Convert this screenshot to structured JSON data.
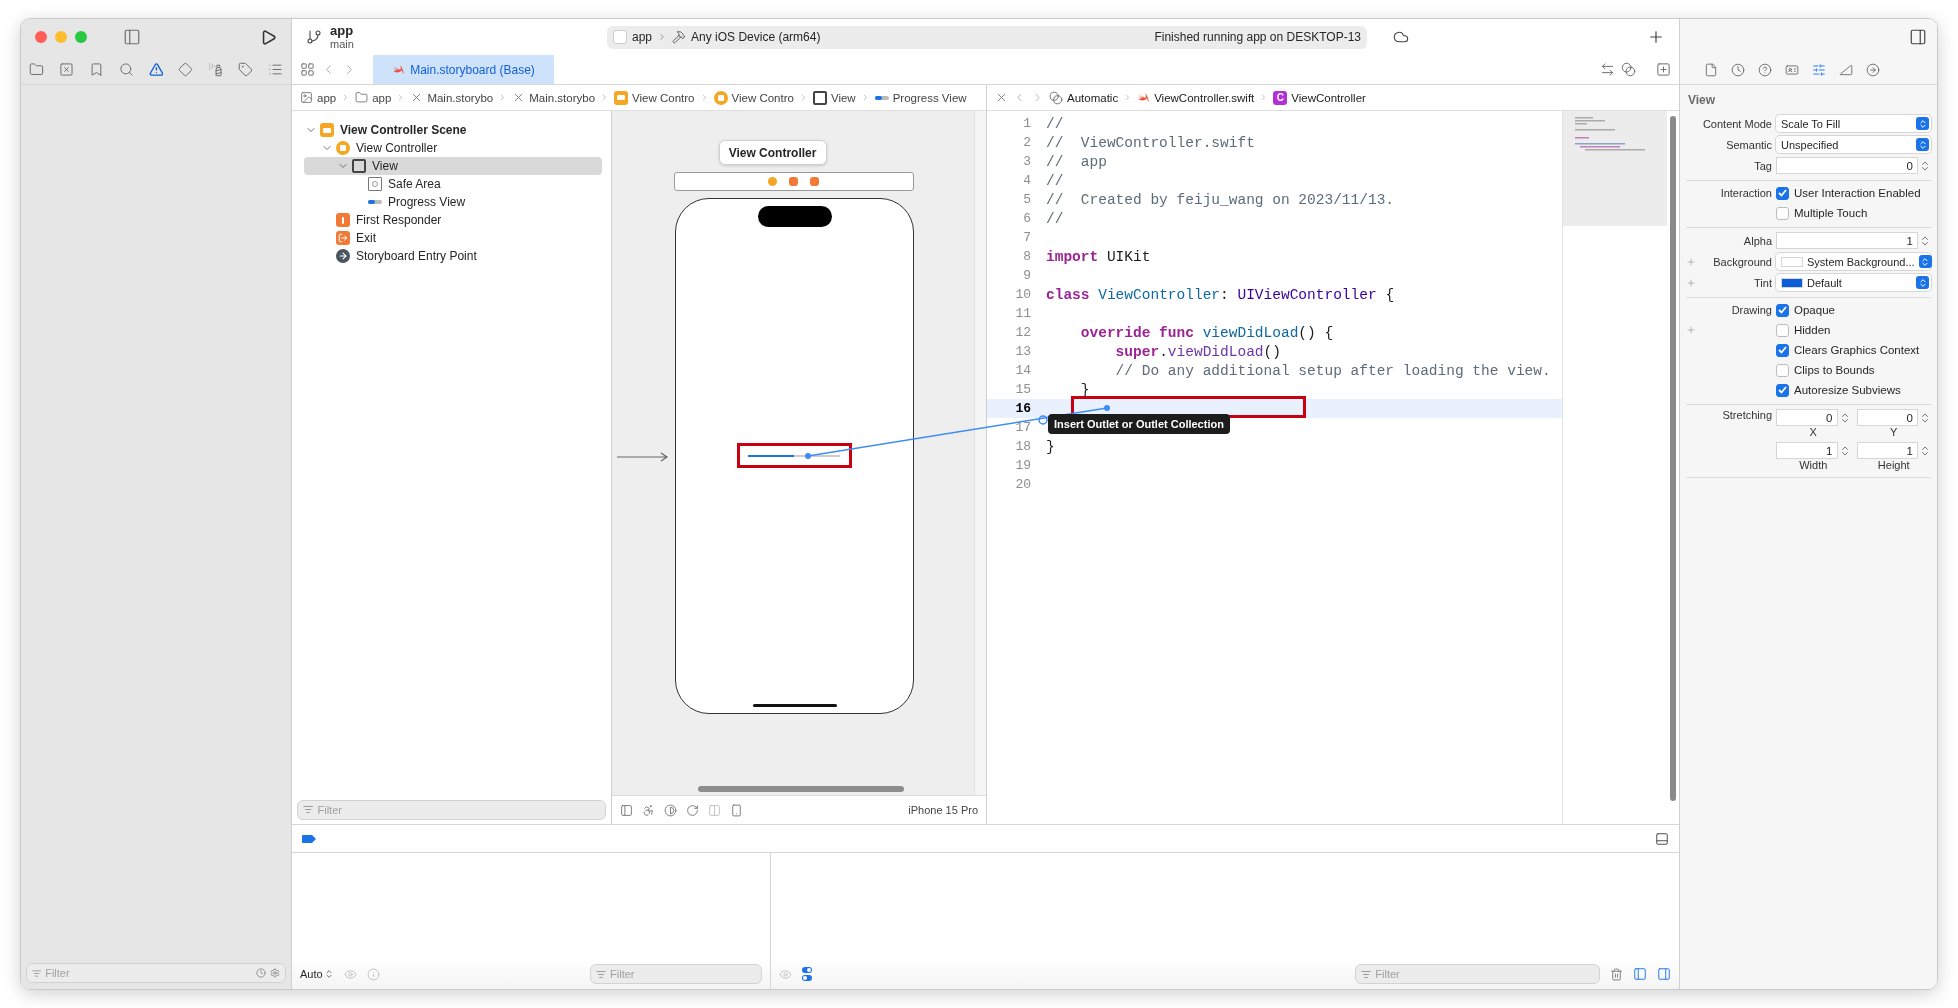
{
  "toolbar": {
    "project": "app",
    "branch": "main",
    "scheme": "app",
    "destination": "Any iOS Device (arm64)",
    "status": "Finished running app on DESKTOP-13"
  },
  "navigator": {
    "filter": {
      "placeholder": "Filter"
    }
  },
  "editor_tabs": [
    {
      "label": "Main.storyboard (Base)",
      "selected": true
    }
  ],
  "storyboard": {
    "breadcrumbs": [
      {
        "kind": "project",
        "label": "app"
      },
      {
        "kind": "folder",
        "label": "app"
      },
      {
        "kind": "storyboard",
        "label": "Main.storybo"
      },
      {
        "kind": "storyboard",
        "label": "Main.storybo"
      },
      {
        "kind": "scene",
        "label": "View Contro"
      },
      {
        "kind": "controller",
        "label": "View Contro"
      },
      {
        "kind": "view",
        "label": "View"
      },
      {
        "kind": "progress",
        "label": "Progress View"
      }
    ],
    "outline": [
      {
        "kind": "scene",
        "label": "View Controller Scene",
        "expanded": true,
        "selected": false,
        "children": [
          {
            "kind": "controller",
            "label": "View Controller",
            "expanded": true,
            "selected": false,
            "children": [
              {
                "kind": "view",
                "label": "View",
                "expanded": true,
                "selected": true,
                "children": [
                  {
                    "kind": "safe-area",
                    "label": "Safe Area",
                    "selected": false
                  },
                  {
                    "kind": "progress",
                    "label": "Progress View",
                    "selected": false
                  }
                ]
              }
            ]
          },
          {
            "kind": "responder",
            "label": "First Responder",
            "selected": false
          },
          {
            "kind": "exit",
            "label": "Exit",
            "selected": false
          },
          {
            "kind": "entry",
            "label": "Storyboard Entry Point",
            "selected": false
          }
        ]
      }
    ],
    "outline_filter": {
      "placeholder": "Filter"
    },
    "scene_title": "View Controller",
    "device": "iPhone 15 Pro"
  },
  "assistant": {
    "breadcrumbs": [
      {
        "kind": "mode",
        "label": "Automatic"
      },
      {
        "kind": "file",
        "label": "ViewController.swift"
      },
      {
        "kind": "class",
        "badge": "C",
        "label": "ViewController"
      }
    ],
    "lines": [
      {
        "number": "1",
        "highlighted": false,
        "tokens": [
          {
            "kind": "comment",
            "text": "//"
          }
        ]
      },
      {
        "number": "2",
        "highlighted": false,
        "tokens": [
          {
            "kind": "comment",
            "text": "//  ViewController.swift"
          }
        ]
      },
      {
        "number": "3",
        "highlighted": false,
        "tokens": [
          {
            "kind": "comment",
            "text": "//  app"
          }
        ]
      },
      {
        "number": "4",
        "highlighted": false,
        "tokens": [
          {
            "kind": "comment",
            "text": "//"
          }
        ]
      },
      {
        "number": "5",
        "highlighted": false,
        "tokens": [
          {
            "kind": "comment",
            "text": "//  Created by feiju_wang on 2023/11/13."
          }
        ]
      },
      {
        "number": "6",
        "highlighted": false,
        "tokens": [
          {
            "kind": "comment",
            "text": "//"
          }
        ]
      },
      {
        "number": "7",
        "highlighted": false
      },
      {
        "number": "8",
        "highlighted": false,
        "tokens": [
          {
            "kind": "keyword",
            "text": "import"
          },
          {
            "kind": "plain",
            "text": " UIKit"
          }
        ]
      },
      {
        "number": "9",
        "highlighted": false
      },
      {
        "number": "10",
        "highlighted": false,
        "tokens": [
          {
            "kind": "keyword",
            "text": "class"
          },
          {
            "kind": "decl",
            "text": " ViewController"
          },
          {
            "kind": "plain",
            "text": ": "
          },
          {
            "kind": "type",
            "text": "UIViewController"
          },
          {
            "kind": "plain",
            "text": " {"
          }
        ]
      },
      {
        "number": "11",
        "highlighted": false
      },
      {
        "number": "12",
        "highlighted": false,
        "tokens": [
          {
            "kind": "keyword",
            "text": "    override func"
          },
          {
            "kind": "decl",
            "text": " viewDidLoad"
          },
          {
            "kind": "plain",
            "text": "() {"
          }
        ]
      },
      {
        "number": "13",
        "highlighted": false,
        "tokens": [
          {
            "kind": "keyword",
            "text": "        super"
          },
          {
            "kind": "plain",
            "text": "."
          },
          {
            "kind": "call",
            "text": "viewDidLoad"
          },
          {
            "kind": "plain",
            "text": "()"
          }
        ]
      },
      {
        "number": "14",
        "highlighted": false,
        "tokens": [
          {
            "kind": "comment",
            "text": "        // Do any additional setup after loading the view."
          }
        ]
      },
      {
        "number": "15",
        "highlighted": false,
        "tokens": [
          {
            "kind": "plain",
            "text": "    }"
          }
        ]
      },
      {
        "number": "16",
        "highlighted": true
      },
      {
        "number": "17",
        "highlighted": false
      },
      {
        "number": "18",
        "highlighted": false,
        "tokens": [
          {
            "kind": "plain",
            "text": "}"
          }
        ]
      },
      {
        "number": "19",
        "highlighted": false
      },
      {
        "number": "20",
        "highlighted": false
      }
    ],
    "tooltip": "Insert Outlet or Outlet Collection"
  },
  "inspector": {
    "title": "View",
    "sections": [
      [
        {
          "kind": "popup",
          "label": "Content Mode",
          "value": "Scale To Fill",
          "plus": false
        },
        {
          "kind": "popup",
          "label": "Semantic",
          "value": "Unspecified",
          "plus": false
        },
        {
          "kind": "stepper",
          "label": "Tag",
          "value": "0",
          "plus": false
        }
      ],
      [
        {
          "kind": "checkbox",
          "label": "Interaction",
          "text": "User Interaction Enabled",
          "checked": true,
          "plus": false
        },
        {
          "kind": "checkbox",
          "text": "Multiple Touch",
          "checked": false,
          "plus": false
        }
      ],
      [
        {
          "kind": "stepper",
          "label": "Alpha",
          "value": "1",
          "plus": false
        },
        {
          "kind": "color",
          "label": "Background",
          "value": "System Background...",
          "color": "#ffffff",
          "plus": true
        },
        {
          "kind": "color",
          "label": "Tint",
          "value": "Default",
          "color": "#0b5ed7",
          "plus": true
        }
      ],
      [
        {
          "kind": "checkbox",
          "label": "Drawing",
          "text": "Opaque",
          "checked": true,
          "plus": false
        },
        {
          "kind": "checkbox",
          "text": "Hidden",
          "checked": false,
          "plus": true
        },
        {
          "kind": "checkbox",
          "text": "Clears Graphics Context",
          "checked": true,
          "plus": false
        },
        {
          "kind": "checkbox",
          "text": "Clips to Bounds",
          "checked": false,
          "plus": false
        },
        {
          "kind": "checkbox",
          "text": "Autoresize Subviews",
          "checked": true,
          "plus": false
        }
      ],
      [
        {
          "kind": "pair",
          "label": "Stretching",
          "plus": false,
          "fields": [
            {
              "value": "0",
              "caption": "X"
            },
            {
              "value": "0",
              "caption": "Y"
            }
          ]
        },
        {
          "kind": "pair",
          "plus": false,
          "fields": [
            {
              "value": "1",
              "caption": "Width"
            },
            {
              "value": "1",
              "caption": "Height"
            }
          ]
        }
      ]
    ]
  },
  "debug": {
    "mode": "Auto",
    "variables_filter": {
      "placeholder": "Filter"
    },
    "console_filter": {
      "placeholder": "Filter"
    }
  }
}
